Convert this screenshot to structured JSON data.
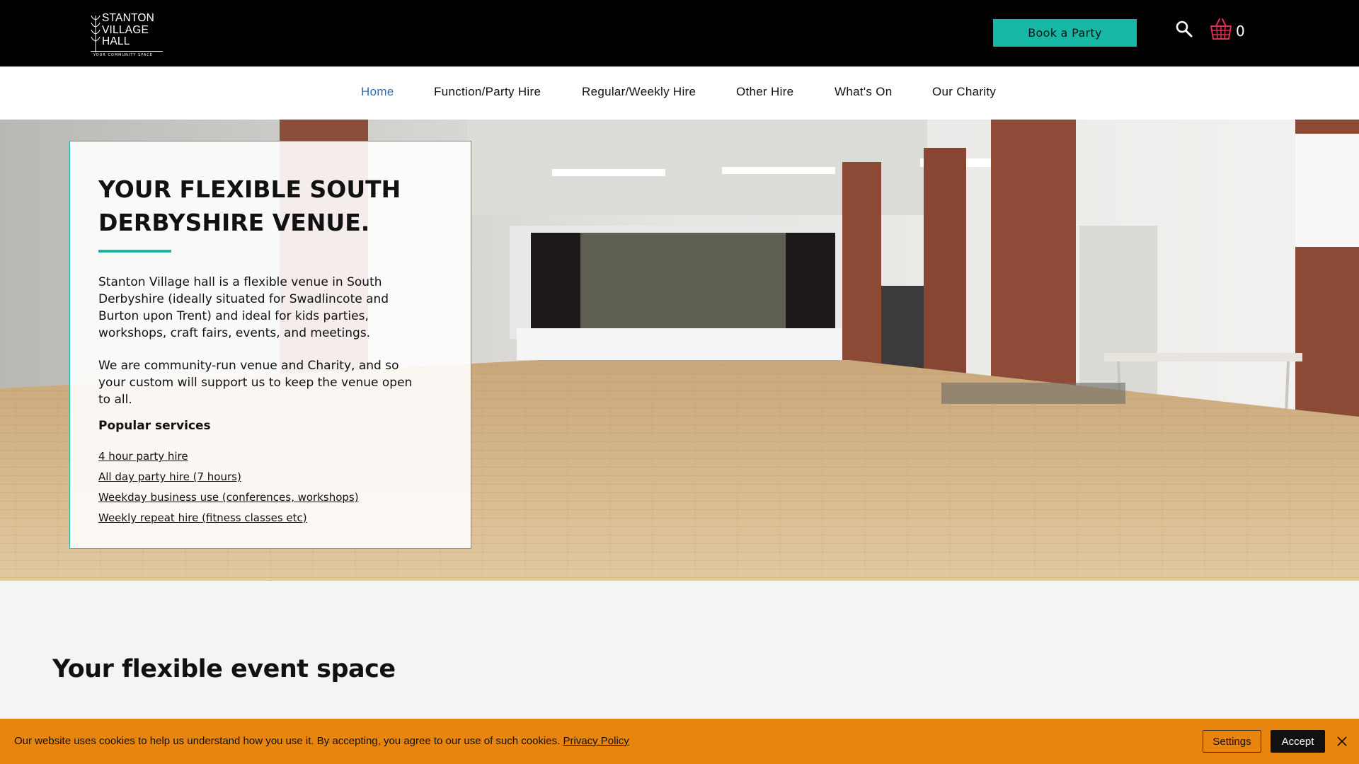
{
  "header": {
    "logo": {
      "name": "STANTON\nVILLAGE\nHALL",
      "tagline": "YOUR COMMUNITY SPACE",
      "icon": "leaf-icon"
    },
    "book_button": "Book a Party",
    "search_icon": "search-icon",
    "cart_icon": "basket-icon",
    "cart_count": "0"
  },
  "nav": {
    "items": [
      {
        "label": "Home",
        "active": true
      },
      {
        "label": "Function/Party Hire"
      },
      {
        "label": "Regular/Weekly Hire"
      },
      {
        "label": "Other Hire"
      },
      {
        "label": "What's On"
      },
      {
        "label": "Our Charity"
      }
    ]
  },
  "hero": {
    "title": "YOUR FLEXIBLE SOUTH DERBYSHIRE VENUE.",
    "paragraph1": "Stanton Village hall is a flexible venue in South Derbyshire (ideally situated for Swadlincote and Burton upon Trent) and ideal for kids parties, workshops, craft fairs, events, and meetings.",
    "paragraph2": "We are community-run venue and Charity, and so your custom will support us to keep the venue open to all.",
    "popular_heading": "Popular services",
    "services": [
      "4 hour party hire",
      "All day party hire (7 hours)",
      "Weekday business use (conferences, workshops)",
      "Weekly repeat hire (fitness classes etc)"
    ]
  },
  "section": {
    "title": "Your flexible event space"
  },
  "cookie": {
    "text": "Our website uses cookies to help us understand how you use it. By accepting, you agree to our use of such cookies.",
    "link": "Privacy Policy",
    "settings": "Settings",
    "accept": "Accept",
    "close_icon": "close-icon"
  },
  "colors": {
    "accent": "#17b8a6",
    "nav_active": "#2f6fb0",
    "cookie_bg": "#e8850f",
    "cart": "#e0304f"
  }
}
